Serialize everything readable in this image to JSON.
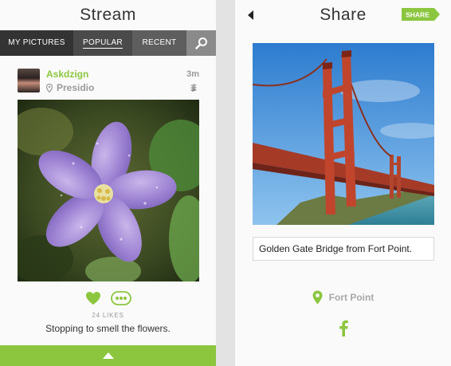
{
  "stream": {
    "title": "Stream",
    "tabs": [
      {
        "label": "MY PICTURES"
      },
      {
        "label": "POPULAR"
      },
      {
        "label": "RECENT"
      }
    ],
    "post": {
      "username": "Askdzign",
      "location": "Presidio",
      "time_ago": "3m",
      "likes": "24 LIKES",
      "caption": "Stopping to smell the flowers."
    }
  },
  "share": {
    "title": "Share",
    "share_button": "SHARE",
    "caption_value": "Golden Gate Bridge from Fort Point.",
    "location": "Fort Point"
  },
  "colors": {
    "accent": "#8cc63f",
    "muted": "#9a9a9a",
    "tab_bar": "#3a3a3a"
  },
  "icons": [
    "search-icon",
    "location-pin-icon",
    "stack-icon",
    "heart-icon",
    "more-icon",
    "chevron-up-icon",
    "back-arrow-icon",
    "facebook-icon"
  ]
}
